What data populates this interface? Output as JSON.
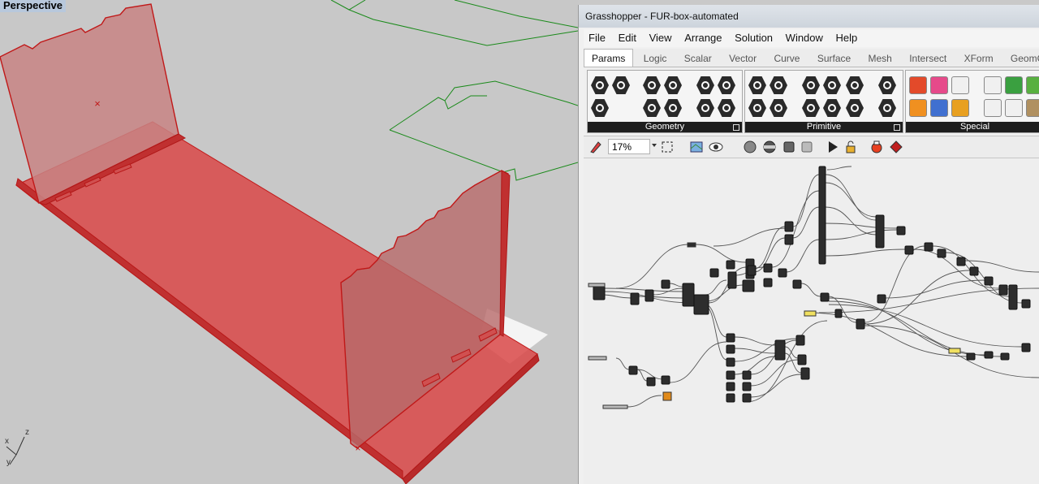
{
  "viewport": {
    "label": "Perspective",
    "axis": {
      "x": "x",
      "y": "y",
      "z": "z"
    },
    "colors": {
      "background": "#c8c8c8",
      "box_fill": "#d94848",
      "box_edge": "#c01818",
      "curve": "#1a8a1a"
    }
  },
  "grasshopper": {
    "title": "Grasshopper - FUR-box-automated",
    "menu": [
      "File",
      "Edit",
      "View",
      "Arrange",
      "Solution",
      "Window",
      "Help"
    ],
    "tabs": [
      "Params",
      "Logic",
      "Scalar",
      "Vector",
      "Curve",
      "Surface",
      "Mesh",
      "Intersect",
      "XForm",
      "GeomGyr"
    ],
    "active_tab": "Params",
    "groups": [
      "Geometry",
      "Primitive",
      "Special"
    ],
    "zoom": "17%",
    "colors": {
      "canvas": "#eeeeee",
      "node": "#2d2d2d",
      "wire": "#555555",
      "panel": "#f0e060",
      "highlight": "#e08a1a"
    }
  }
}
